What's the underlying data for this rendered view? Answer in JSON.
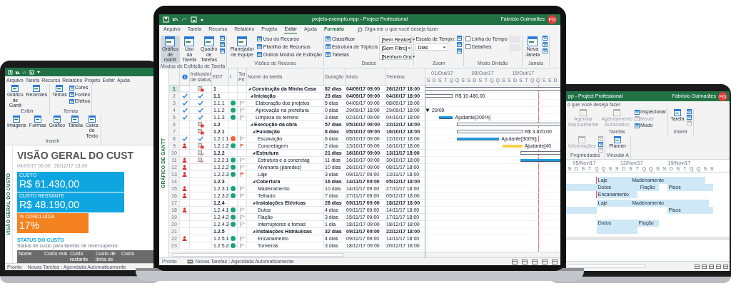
{
  "main": {
    "title_bar": {
      "title": "projeto-exemplo.mpp - Project Professional",
      "user": "Fabrício Guimarães",
      "avatar": "FG"
    },
    "tabs": [
      {
        "label": "Arquivo",
        "selected": false,
        "contextual": false
      },
      {
        "label": "Tarefa",
        "selected": false,
        "contextual": false
      },
      {
        "label": "Recurso",
        "selected": false,
        "contextual": false
      },
      {
        "label": "Relatório",
        "selected": false,
        "contextual": false
      },
      {
        "label": "Projeto",
        "selected": false,
        "contextual": false
      },
      {
        "label": "Exibir",
        "selected": true,
        "contextual": false
      },
      {
        "label": "Ajuda",
        "selected": false,
        "contextual": false
      },
      {
        "label": "Formato",
        "selected": false,
        "contextual": true
      }
    ],
    "search_hint": "Diga-me o que você deseja fazer",
    "ribbon": [
      {
        "label": "Modos de Exibição de Tarefa",
        "columns": [
          [
            {
              "kind": "large",
              "label": "Gráfico de Gantt",
              "selected": true
            }
          ],
          [
            {
              "kind": "large",
              "label": "Uso da Tarefa",
              "selected": false
            }
          ],
          [
            {
              "kind": "large",
              "label": "Quadro de Tarefas",
              "selected": false
            }
          ],
          [
            {
              "kind": "icon"
            },
            {
              "kind": "icon"
            },
            {
              "kind": "icon"
            }
          ]
        ]
      },
      {
        "label": "Visões de Recurso",
        "columns": [
          [
            {
              "kind": "large",
              "label": "Planejador de Equipe"
            }
          ],
          [
            {
              "kind": "small",
              "label": "Uso do Recurso"
            },
            {
              "kind": "small",
              "label": "Planilha de Recursos"
            },
            {
              "kind": "small",
              "label": "Outros Modos de Exibição"
            }
          ]
        ]
      },
      {
        "label": "Dados",
        "columns": [
          [
            {
              "kind": "small",
              "label": "Classificar"
            },
            {
              "kind": "small",
              "label": "Estrutura de Tópicos"
            },
            {
              "kind": "small",
              "label": "Tabelas"
            }
          ],
          [
            {
              "kind": "combo",
              "value": "[Sem Realce]"
            },
            {
              "kind": "combo",
              "value": "[Sem Filtro]"
            },
            {
              "kind": "combo",
              "value": "[Nenhum Gru"
            }
          ]
        ]
      },
      {
        "label": "Zoom",
        "columns": [
          [
            {
              "kind": "text",
              "label": "Escala de Tempo:"
            },
            {
              "kind": "combo",
              "value": "Dias"
            }
          ],
          [
            {
              "kind": "icon"
            },
            {
              "kind": "icon"
            },
            {
              "kind": "icon"
            }
          ]
        ]
      },
      {
        "label": "Modo Divisão",
        "columns": [
          [
            {
              "kind": "check",
              "label": "Linha do Tempo",
              "checked": false
            },
            {
              "kind": "check",
              "label": "Detalhes",
              "checked": false
            }
          ],
          [
            {
              "kind": "combo",
              "disabled": true
            },
            {
              "kind": "combo",
              "disabled": true
            }
          ]
        ]
      },
      {
        "label": "Janela",
        "columns": [
          [
            {
              "kind": "large",
              "label": "Nova Janela"
            }
          ],
          [
            {
              "kind": "icon"
            },
            {
              "kind": "icon"
            },
            {
              "kind": "icon"
            }
          ]
        ]
      }
    ],
    "side_label": "GRÁFICO DE GANTT",
    "table": {
      "columns": [
        "Indicador de status",
        "EDT",
        "I",
        "Tar Pri",
        "Nome da tarefa",
        "Duração",
        "Início",
        "Término"
      ],
      "rows": [
        {
          "id": "1",
          "selected": true,
          "status": {
            "kind": "late"
          },
          "wbs": "1",
          "name": "Construção da Minha Casa",
          "duration": "82 dias",
          "start": "04/09/17 09:00",
          "end": "26/12/17 18:00",
          "expanded": true,
          "bar": {
            "kind": "summary"
          },
          "children": [
            {
              "id": "2",
              "selected": false,
              "indicator": {
                "kind": "check"
              },
              "status": {
                "kind": "check"
              },
              "wbs": "1.1",
              "name": "Iniciação",
              "duration": "23 dias",
              "start": "04/09/17 09:00",
              "end": "04/10/17 18:00",
              "expanded": true,
              "bar": {
                "kind": "summary",
                "label": "R$ 10.480,00"
              },
              "children": [
                {
                  "id": "3",
                  "selected": false,
                  "indicator": {
                    "kind": "check"
                  },
                  "status": {
                    "kind": "check"
                  },
                  "wbs": "1.1.1",
                  "name": "Elaboração dos projetos",
                  "duration": "5 dias",
                  "start": "04/09/17 09:00",
                  "end": "08/09/17 18:00",
                  "color": "#1aa37a",
                  "flagged": false
                },
                {
                  "id": "4",
                  "selected": false,
                  "indicator": {
                    "kind": "check"
                  },
                  "status": {
                    "kind": "check"
                  },
                  "wbs": "1.1.2",
                  "name": "Aprovação na prefeitura",
                  "duration": "0 dias",
                  "start": "29/09/17 18:00",
                  "end": "29/09/17 18:00",
                  "color": "#1aa37a",
                  "flagged": false,
                  "bar": {
                    "kind": "milestone",
                    "label": "29/09"
                  }
                },
                {
                  "id": "5",
                  "selected": false,
                  "indicator": {
                    "kind": "check"
                  },
                  "status": {
                    "kind": "check"
                  },
                  "wbs": "1.1.3",
                  "name": "Limpeza do terreno",
                  "duration": "3 dias",
                  "start": "02/10/17 09:00",
                  "end": "04/10/17 18:00",
                  "color": "#1aa37a",
                  "flagged": false,
                  "bar": {
                    "kind": "task",
                    "label": "Ajudante[200%]"
                  }
                }
              ]
            },
            {
              "id": "6",
              "selected": false,
              "status": {
                "kind": "late"
              },
              "wbs": "1.2",
              "name": "Execução da obra",
              "duration": "57 dias",
              "start": "05/10/17 09:00",
              "end": "22/12/17 18:00",
              "expanded": true,
              "bar": {
                "kind": "summary"
              },
              "children": [
                {
                  "id": "7",
                  "selected": false,
                  "status": {
                    "kind": "late"
                  },
                  "wbs": "1.2.1",
                  "name": "Fundação",
                  "duration": "8 dias",
                  "start": "05/10/17 09:00",
                  "end": "16/10/17 18:00",
                  "expanded": true,
                  "bar": {
                    "kind": "summary",
                    "label": "R$ 3.820,00"
                  },
                  "children": [
                    {
                      "id": "8",
                      "selected": false,
                      "indicator": {
                        "kind": "check"
                      },
                      "status": {
                        "kind": "check"
                      },
                      "wbs": "1.2.1.1",
                      "name": "Escavação",
                      "duration": "6 dias",
                      "start": "05/10/17 09:00",
                      "end": "12/10/17 18:00",
                      "color": "#f0643c",
                      "flagged": false,
                      "bar": {
                        "kind": "task",
                        "label": "Ajudante[300%]"
                      }
                    },
                    {
                      "id": "9",
                      "selected": false,
                      "indicator": {
                        "kind": "person"
                      },
                      "status": {
                        "kind": "late"
                      },
                      "wbs": "1.2.1.2",
                      "name": "Concretagem",
                      "duration": "2 dias",
                      "start": "13/10/17 09:00",
                      "end": "16/10/17 18:00",
                      "color": "#1aa37a",
                      "flagged": true,
                      "bar": {
                        "kind": "highlight",
                        "label": "Ajudante[40"
                      }
                    }
                  ]
                },
                {
                  "id": "10",
                  "selected": false,
                  "status": {
                    "kind": "pending"
                  },
                  "wbs": "1.2.2",
                  "name": "Estrutura",
                  "duration": "21 dias",
                  "start": "16/10/17 09:00",
                  "end": "13/11/17 18:00",
                  "expanded": true,
                  "bar": {
                    "kind": "summary"
                  },
                  "children": [
                    {
                      "id": "11",
                      "selected": false,
                      "indicator": {
                        "kind": "person"
                      },
                      "status": {
                        "kind": "pending"
                      },
                      "wbs": "1.2.2.1",
                      "name": "Estrutura e a concretag",
                      "duration": "11 dias",
                      "start": "16/10/17 09:00",
                      "end": "30/10/17 18:00",
                      "color": "#1aa37a",
                      "flagged": false,
                      "bar": {
                        "kind": "task"
                      }
                    },
                    {
                      "id": "12",
                      "selected": false,
                      "indicator": {
                        "kind": "person"
                      },
                      "wbs": "1.2.2.2",
                      "name": "Alvenaria (paredes)",
                      "duration": "10 dias",
                      "start": "26/10/17 09:00",
                      "end": "08/11/17 18:00",
                      "color": "#1aa37a",
                      "flagged": false
                    },
                    {
                      "id": "13",
                      "selected": false,
                      "indicator": {
                        "kind": "person"
                      },
                      "wbs": "1.2.2.3",
                      "name": "Laje",
                      "duration": "3 dias",
                      "start": "09/11/17 09:00",
                      "end": "13/11/17 18:00",
                      "color": "#1aa37a",
                      "flagged": true
                    }
                  ]
                },
                {
                  "id": "14",
                  "selected": false,
                  "wbs": "1.2.3",
                  "name": "Cobertura",
                  "duration": "16 dias",
                  "start": "14/11/17 09:00",
                  "end": "05/12/17 18:00",
                  "expanded": true,
                  "children": [
                    {
                      "id": "15",
                      "selected": false,
                      "indicator": {
                        "kind": "person"
                      },
                      "wbs": "1.2.3.1",
                      "name": "Madeiramento",
                      "duration": "10 dias",
                      "start": "14/11/17 09:00",
                      "end": "27/11/17 18:00",
                      "color": "#1aa37a",
                      "flagged": false
                    },
                    {
                      "id": "16",
                      "selected": false,
                      "indicator": {
                        "kind": "person"
                      },
                      "wbs": "1.2.3.2",
                      "name": "Telhado",
                      "duration": "7 dias",
                      "start": "27/11/17 09:00",
                      "end": "05/12/17 18:00",
                      "color": "#1aa37a",
                      "flagged": false
                    }
                  ]
                },
                {
                  "id": "17",
                  "selected": false,
                  "wbs": "1.2.4",
                  "name": "Instalações Elétricas",
                  "duration": "28 dias",
                  "start": "09/11/17 09:00",
                  "end": "18/12/17 18:00",
                  "expanded": true,
                  "children": [
                    {
                      "id": "18",
                      "selected": false,
                      "indicator": {
                        "kind": "person"
                      },
                      "wbs": "1.2.4.1",
                      "name": "Dutos",
                      "duration": "4 dias",
                      "start": "09/11/17 09:00",
                      "end": "14/11/17 18:00",
                      "color": "#1aa37a",
                      "flagged": false
                    },
                    {
                      "id": "19",
                      "selected": false,
                      "wbs": "1.2.4.2",
                      "name": "Fiação",
                      "duration": "3 dias",
                      "start": "15/11/17 09:00",
                      "end": "17/11/17 18:00",
                      "color": "#1aa37a",
                      "flagged": false
                    },
                    {
                      "id": "20",
                      "selected": false,
                      "wbs": "1.2.4.3",
                      "name": "Interruptores e tomad",
                      "duration": "1 dia",
                      "start": "18/12/17 09:00",
                      "end": "18/12/17 18:00",
                      "color": "#1aa37a",
                      "flagged": false
                    }
                  ]
                },
                {
                  "id": "21",
                  "selected": false,
                  "wbs": "1.2.5",
                  "name": "Instalações Hidráulicas",
                  "duration": "32 dias",
                  "start": "09/11/17 09:00",
                  "end": "22/12/17 18:00",
                  "expanded": true,
                  "children": [
                    {
                      "id": "22",
                      "selected": false,
                      "indicator": {
                        "kind": "person"
                      },
                      "wbs": "1.2.5.1",
                      "name": "Encanamento",
                      "duration": "4 dias",
                      "start": "09/11/17 09:00",
                      "end": "14/11/17 18:00",
                      "color": "#1aa37a",
                      "flagged": false
                    },
                    {
                      "id": "23",
                      "selected": false,
                      "wbs": "1.2.5.2",
                      "name": "Torneiras",
                      "duration": "3 dias",
                      "start": "18/12/17 09:00",
                      "end": "20/12/17 18:00",
                      "color": "#1aa37a",
                      "flagged": false
                    }
                  ]
                }
              ]
            }
          ]
        }
      ]
    },
    "gantt": {
      "weeks": [
        "01/Out/17",
        "08/Out/17",
        "15/Out/17"
      ],
      "days": [
        "S",
        "D",
        "S",
        "T",
        "Q",
        "Q",
        "S",
        "S",
        "D",
        "S",
        "T",
        "Q",
        "Q",
        "S",
        "S",
        "D",
        "S",
        "T",
        "Q",
        "Q",
        "S",
        "S",
        "D"
      ]
    },
    "status_bar": {
      "state": "Pronto",
      "mode": "Novas Tarefas : Agendada Automaticamente"
    }
  },
  "left": {
    "tabs": [
      "Arquivo",
      "Tarefa",
      "Recurso",
      "Relatório",
      "Projeto",
      "Exibir",
      "Ajuda"
    ],
    "ribbon": [
      {
        "label": "Exibir",
        "columns": [
          [
            {
              "kind": "large",
              "label": "Gráfico de Gantt"
            }
          ],
          [
            {
              "kind": "large",
              "label": "Recentes"
            }
          ]
        ]
      },
      {
        "label": "Temas",
        "columns": [
          [
            {
              "kind": "large",
              "label": "Temas"
            }
          ],
          [
            {
              "kind": "small",
              "label": "Cores"
            },
            {
              "kind": "small",
              "label": "Fontes"
            },
            {
              "kind": "small",
              "label": "Efeitos"
            }
          ]
        ]
      },
      {
        "label": "Inserir",
        "columns": [
          [
            {
              "kind": "large",
              "label": "Imagens"
            }
          ],
          [
            {
              "kind": "large",
              "label": "Formas"
            }
          ],
          [
            {
              "kind": "large",
              "label": "Gráfico"
            }
          ],
          [
            {
              "kind": "large",
              "label": "Tabela"
            }
          ],
          [
            {
              "kind": "large",
              "label": "Caixa de Texto"
            }
          ]
        ]
      }
    ],
    "side_label": "VISÃO GERAL DO CUSTO",
    "report_title": "VISÃO GERAL DO CUST",
    "dates": [
      "04/09/17 09:00",
      "26/12/17 18:00"
    ],
    "cards": [
      {
        "label": "CUSTO",
        "value": "R$ 61.430,00",
        "color": "#0ea5e0"
      },
      {
        "label": "CUSTO RESTANTE",
        "value": "R$ 48.190,00",
        "color": "#0ea5e0"
      },
      {
        "label": "% CONCLUÍDA",
        "value": "17%",
        "color": "#f58220"
      }
    ],
    "section_title": "STATUS DO CUSTO",
    "section_note": "Status de custo para tarefas de nível superior.",
    "table_columns": [
      "Nome",
      "Custo real",
      "Custo restante",
      "Custo de linha de",
      "Custo"
    ],
    "status_bar": {
      "state": "Pronto",
      "mode": "Novas Tarefas : Agendada Automaticamente"
    }
  },
  "right": {
    "title": "pp - Project Professional",
    "user": "Fabrício Guimarães",
    "avatar": "FG",
    "search_hint": "o que você deseja fazer",
    "ribbon": [
      {
        "label": "Tarefas",
        "columns": [
          [
            {
              "kind": "large",
              "label": "Agendar Manualmente",
              "disabled": true
            }
          ],
          [
            {
              "kind": "large",
              "label": "Agendamento Automático",
              "disabled": true
            }
          ],
          [
            {
              "kind": "small",
              "label": "Inspecionar",
              "disabled": false
            },
            {
              "kind": "small",
              "label": "Mover",
              "disabled": true
            },
            {
              "kind": "small",
              "label": "Modo",
              "disabled": false
            }
          ]
        ]
      },
      {
        "label": "Inserir",
        "columns": [
          [
            {
              "kind": "large",
              "label": "Tarefa",
              "disabled": false
            }
          ],
          [
            {
              "kind": "icon",
              "disabled": false
            },
            {
              "kind": "icon",
              "disabled": false
            },
            {
              "kind": "icon",
              "disabled": true
            }
          ]
        ]
      },
      {
        "label": "Propriedades",
        "columns": [
          [
            {
              "kind": "large",
              "label": "Informações",
              "disabled": true
            }
          ],
          [
            {
              "kind": "icon",
              "disabled": true
            },
            {
              "kind": "icon",
              "disabled": false
            },
            {
              "kind": "icon",
              "disabled": true
            }
          ]
        ]
      },
      {
        "label": "Vincular A",
        "columns": [
          [
            {
              "kind": "large",
              "label": "Planner",
              "disabled": false
            }
          ]
        ]
      }
    ],
    "weeks": [
      "05/Nov/17",
      "12/Nov/17",
      "19/Nov/17"
    ],
    "days": [
      "S",
      "D",
      "S",
      "T",
      "Q",
      "Q",
      "S",
      "S",
      "D",
      "S",
      "T",
      "Q",
      "Q",
      "S",
      "S",
      "D",
      "S",
      "T",
      "Q",
      "Q",
      "S",
      "S"
    ],
    "lanes": [
      {
        "overallocated": true,
        "tracks": [
          {
            "blocks": [
              {
                "kind": "assignment",
                "label": "Laje"
              },
              {
                "kind": "assignment",
                "label": "Madeiramento"
              }
            ]
          },
          {
            "blocks": [
              {
                "kind": "continued"
              },
              {
                "kind": "assignment",
                "label": "Dutos"
              },
              {
                "kind": "assignment",
                "label": "Fiação"
              },
              {
                "kind": "assignment",
                "label": "Pisos"
              }
            ]
          },
          {
            "blocks": [
              {
                "kind": "assignment",
                "label": "Encanamento"
              }
            ]
          }
        ]
      },
      {
        "overallocated": false,
        "tracks": [
          {
            "blocks": [
              {
                "kind": "assignment",
                "label": "Laje"
              },
              {
                "kind": "assignment",
                "label": "Madeiramento"
              }
            ]
          },
          {
            "blocks": [
              {
                "kind": "continued"
              },
              {
                "kind": "assignment",
                "label": "Pisos"
              }
            ]
          }
        ]
      },
      {
        "overallocated": false,
        "tracks": [
          {
            "blocks": [
              {
                "kind": "assignment",
                "label": "Dutos"
              },
              {
                "kind": "assignment",
                "label": "Fiação"
              }
            ]
          },
          {
            "blocks": [
              {
                "kind": "continued"
              }
            ]
          }
        ]
      }
    ]
  }
}
